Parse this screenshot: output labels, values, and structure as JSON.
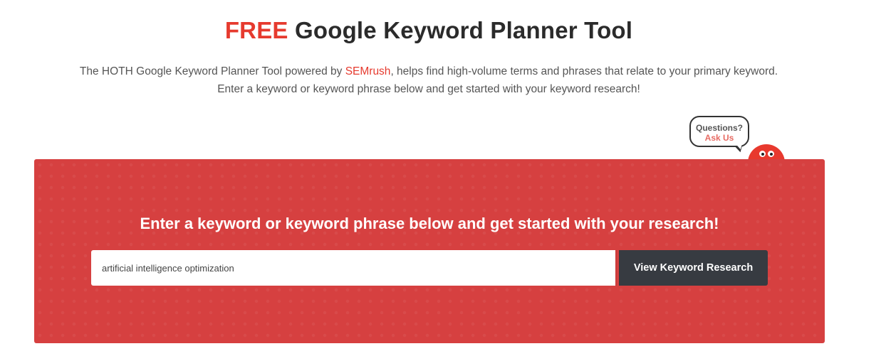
{
  "header": {
    "title_accent": "FREE",
    "title_rest": " Google Keyword Planner Tool",
    "intro_before": "The HOTH Google Keyword Planner Tool powered by ",
    "intro_link": "SEMrush",
    "intro_after": ", helps find high-volume terms and phrases that relate to your primary keyword.",
    "intro_line2": "Enter a keyword or keyword phrase below and get started with your keyword research!"
  },
  "help_widget": {
    "line1": "Questions?",
    "line2": "Ask Us"
  },
  "hero": {
    "heading": "Enter a keyword or keyword phrase below and get started with your research!",
    "search_value": "artificial intelligence optimization",
    "button_label": "View Keyword Research"
  },
  "colors": {
    "accent": "#e63a2e",
    "hero_background": "#d64040",
    "button_background": "#373b41"
  },
  "icons": {
    "mascot": "hoth-mascot-icon",
    "bubble": "speech-bubble-icon"
  }
}
